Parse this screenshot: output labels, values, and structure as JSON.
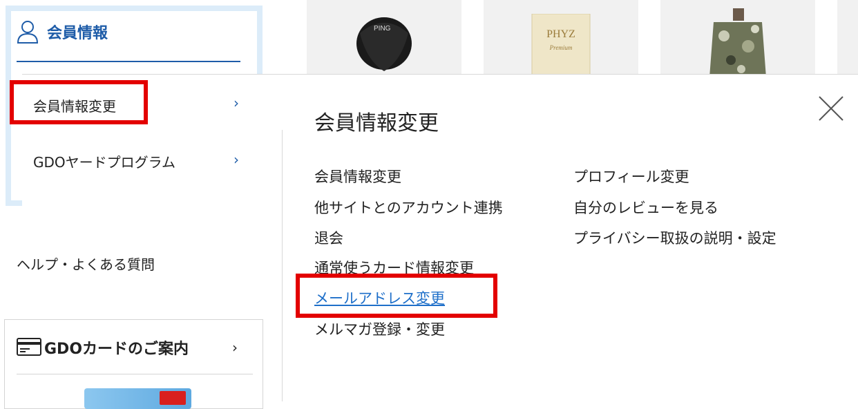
{
  "products": [
    {
      "name": "driver"
    },
    {
      "brand": "PHYZ",
      "sub": "Premium"
    },
    {
      "name": "jacket"
    }
  ],
  "member": {
    "title": "会員情報",
    "items": [
      {
        "label": "会員情報変更"
      },
      {
        "label": "GDOヤードプログラム"
      }
    ]
  },
  "help": {
    "label": "ヘルプ・よくある質問"
  },
  "card": {
    "title": "GDOカードのご案内"
  },
  "flyout": {
    "title": "会員情報変更",
    "left_links": [
      "会員情報変更",
      "他サイトとのアカウント連携",
      "退会",
      "通常使うカード情報変更",
      "メールアドレス変更",
      "メルマガ登録・変更"
    ],
    "right_links": [
      "プロフィール変更",
      "自分のレビューを見る",
      "プライバシー取扱の説明・設定"
    ]
  },
  "colors": {
    "accent": "#1e5ca8",
    "link_active": "#1e6fc9",
    "highlight": "#e30000",
    "box_border": "#dcecf9"
  }
}
